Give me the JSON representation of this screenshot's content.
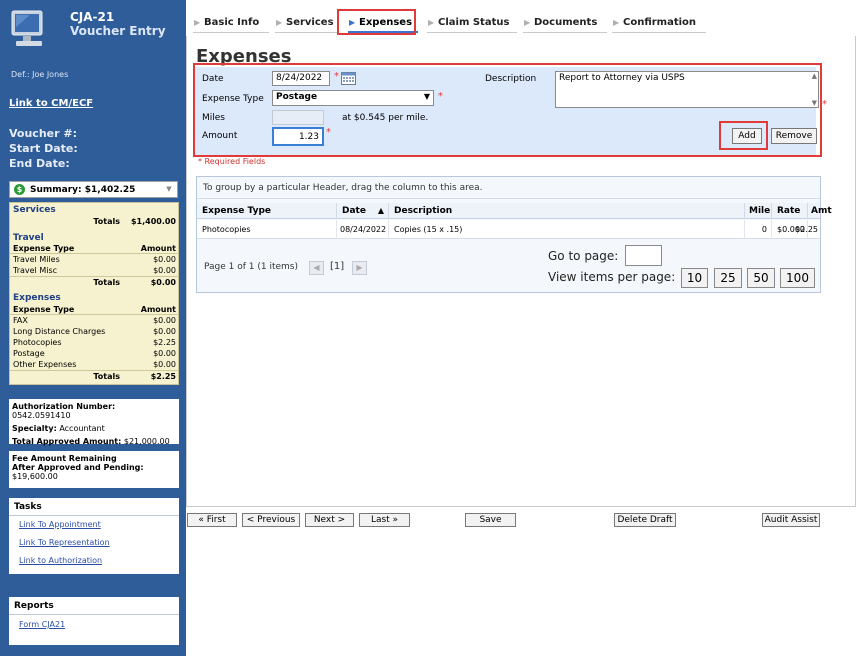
{
  "app": {
    "title": "CJA-21",
    "subtitle": "Voucher Entry"
  },
  "sidebar": {
    "defendant": "Def.: Joe Jones",
    "link_cmecf": "Link to CM/ECF",
    "voucher_label": "Voucher #:",
    "start_date_label": "Start Date:",
    "end_date_label": "End Date:",
    "summary_select": "Summary: $1,402.25",
    "summary": {
      "services": {
        "header": "Services",
        "totals_label": "Totals",
        "totals": "$1,400.00"
      },
      "travel": {
        "header": "Travel",
        "col_type": "Expense Type",
        "col_amount": "Amount",
        "rows": [
          {
            "type": "Travel Miles",
            "amount": "$0.00"
          },
          {
            "type": "Travel Misc",
            "amount": "$0.00"
          }
        ],
        "totals_label": "Totals",
        "totals": "$0.00"
      },
      "expenses": {
        "header": "Expenses",
        "col_type": "Expense Type",
        "col_amount": "Amount",
        "rows": [
          {
            "type": "FAX",
            "amount": "$0.00"
          },
          {
            "type": "Long Distance Charges",
            "amount": "$0.00"
          },
          {
            "type": "Photocopies",
            "amount": "$2.25"
          },
          {
            "type": "Postage",
            "amount": "$0.00"
          },
          {
            "type": "Other Expenses",
            "amount": "$0.00"
          }
        ],
        "totals_label": "Totals",
        "totals": "$2.25"
      }
    },
    "auth": {
      "number_label": "Authorization Number:",
      "number": "0542.0591410",
      "specialty_label": "Specialty:",
      "specialty": "Accountant",
      "total_label": "Total Approved Amount:",
      "total": "$21,000.00"
    },
    "fee": {
      "line1": "Fee Amount Remaining",
      "line2": "After Approved and Pending:",
      "amount": "$19,600.00"
    },
    "tasks": {
      "header": "Tasks",
      "links": [
        "Link To Appointment",
        "Link To Representation",
        "Link to Authorization"
      ]
    },
    "reports": {
      "header": "Reports",
      "links": [
        "Form CJA21"
      ]
    }
  },
  "tabs": [
    "Basic Info",
    "Services",
    "Expenses",
    "Claim Status",
    "Documents",
    "Confirmation"
  ],
  "active_tab": "Expenses",
  "page_title": "Expenses",
  "form": {
    "date_label": "Date",
    "date_value": "8/24/2022",
    "expense_type_label": "Expense Type",
    "expense_type_value": "Postage",
    "miles_label": "Miles",
    "miles_value": "",
    "rate_text": "at $0.545 per mile.",
    "amount_label": "Amount",
    "amount_value": "1.23",
    "description_label": "Description",
    "description_value": "Report to Attorney via USPS",
    "add_button": "Add",
    "remove_button": "Remove",
    "required_note": "* Required Fields",
    "required_mark": "*"
  },
  "grid": {
    "group_hint": "To group by a particular Header, drag the column to this area.",
    "columns": [
      "Expense Type",
      "Date",
      "Description",
      "Mile",
      "Rate",
      "Amt"
    ],
    "sort_indicator": "▲",
    "rows": [
      {
        "type": "Photocopies",
        "date": "08/24/2022",
        "description": "Copies (15 x .15)",
        "mile": "0",
        "rate": "$0.000",
        "amt": "$2.25"
      }
    ],
    "pager_text": "Page 1 of 1 (1 items)",
    "current_page": "[1]",
    "goto_label": "Go to page:",
    "view_items_label": "View items per page:",
    "page_sizes": [
      "10",
      "25",
      "50",
      "100"
    ]
  },
  "nav": {
    "first": "« First",
    "previous": "< Previous",
    "next": "Next >",
    "last": "Last »",
    "save": "Save",
    "delete_draft": "Delete Draft",
    "audit": "Audit Assist"
  },
  "colors": {
    "sidebar": "#2f5d9a",
    "form_bg": "#dbe9fb",
    "highlight": "#e13a3a",
    "link": "#2b4da8"
  }
}
